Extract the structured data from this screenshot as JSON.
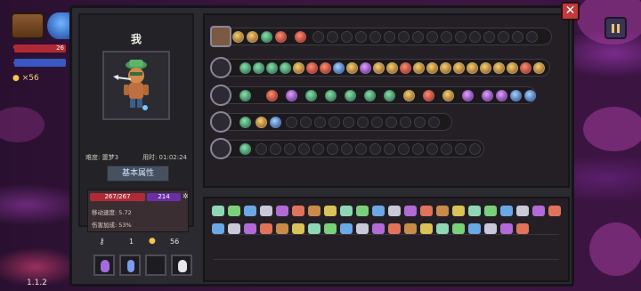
{
  "hud": {
    "hp_text": "26",
    "coin_count": "×56",
    "version": "1.1.2"
  },
  "colors": {
    "hp": "#b02a35",
    "mana": "#6a2ea6",
    "panel": "#2b2a30",
    "accent_gold": "#e8c66a",
    "close": "#c23a3a"
  },
  "character": {
    "name": "我",
    "difficulty": "难度: 噩梦3",
    "time": "用时: 01:02:24",
    "attr_button": "基本属性",
    "hp": "267/267",
    "mp": "214",
    "move_speed": "移动速度: 5.72",
    "damage_bonus": "伤害加成: 53%"
  },
  "resources": {
    "keys": "1",
    "coins": "56"
  },
  "weapons": [
    {
      "name": "chest-row",
      "icon": "chest-icon",
      "filled": 5,
      "total": 20
    },
    {
      "name": "bow-row",
      "icon": "bow-icon",
      "filled": 23,
      "total": 23
    },
    {
      "name": "staff-row",
      "icon": "staff-icon",
      "filled": 17,
      "total": 17
    },
    {
      "name": "wand-row",
      "icon": "wand-icon",
      "filled": 3,
      "total": 15
    },
    {
      "name": "scepter-row",
      "icon": "scepter-icon",
      "filled": 1,
      "total": 17
    }
  ],
  "items": {
    "row1_count": 22,
    "row2_count": 20
  },
  "potions": [
    "purple-potion-icon",
    "blue-potion-icon",
    "",
    "white-potion-icon"
  ]
}
